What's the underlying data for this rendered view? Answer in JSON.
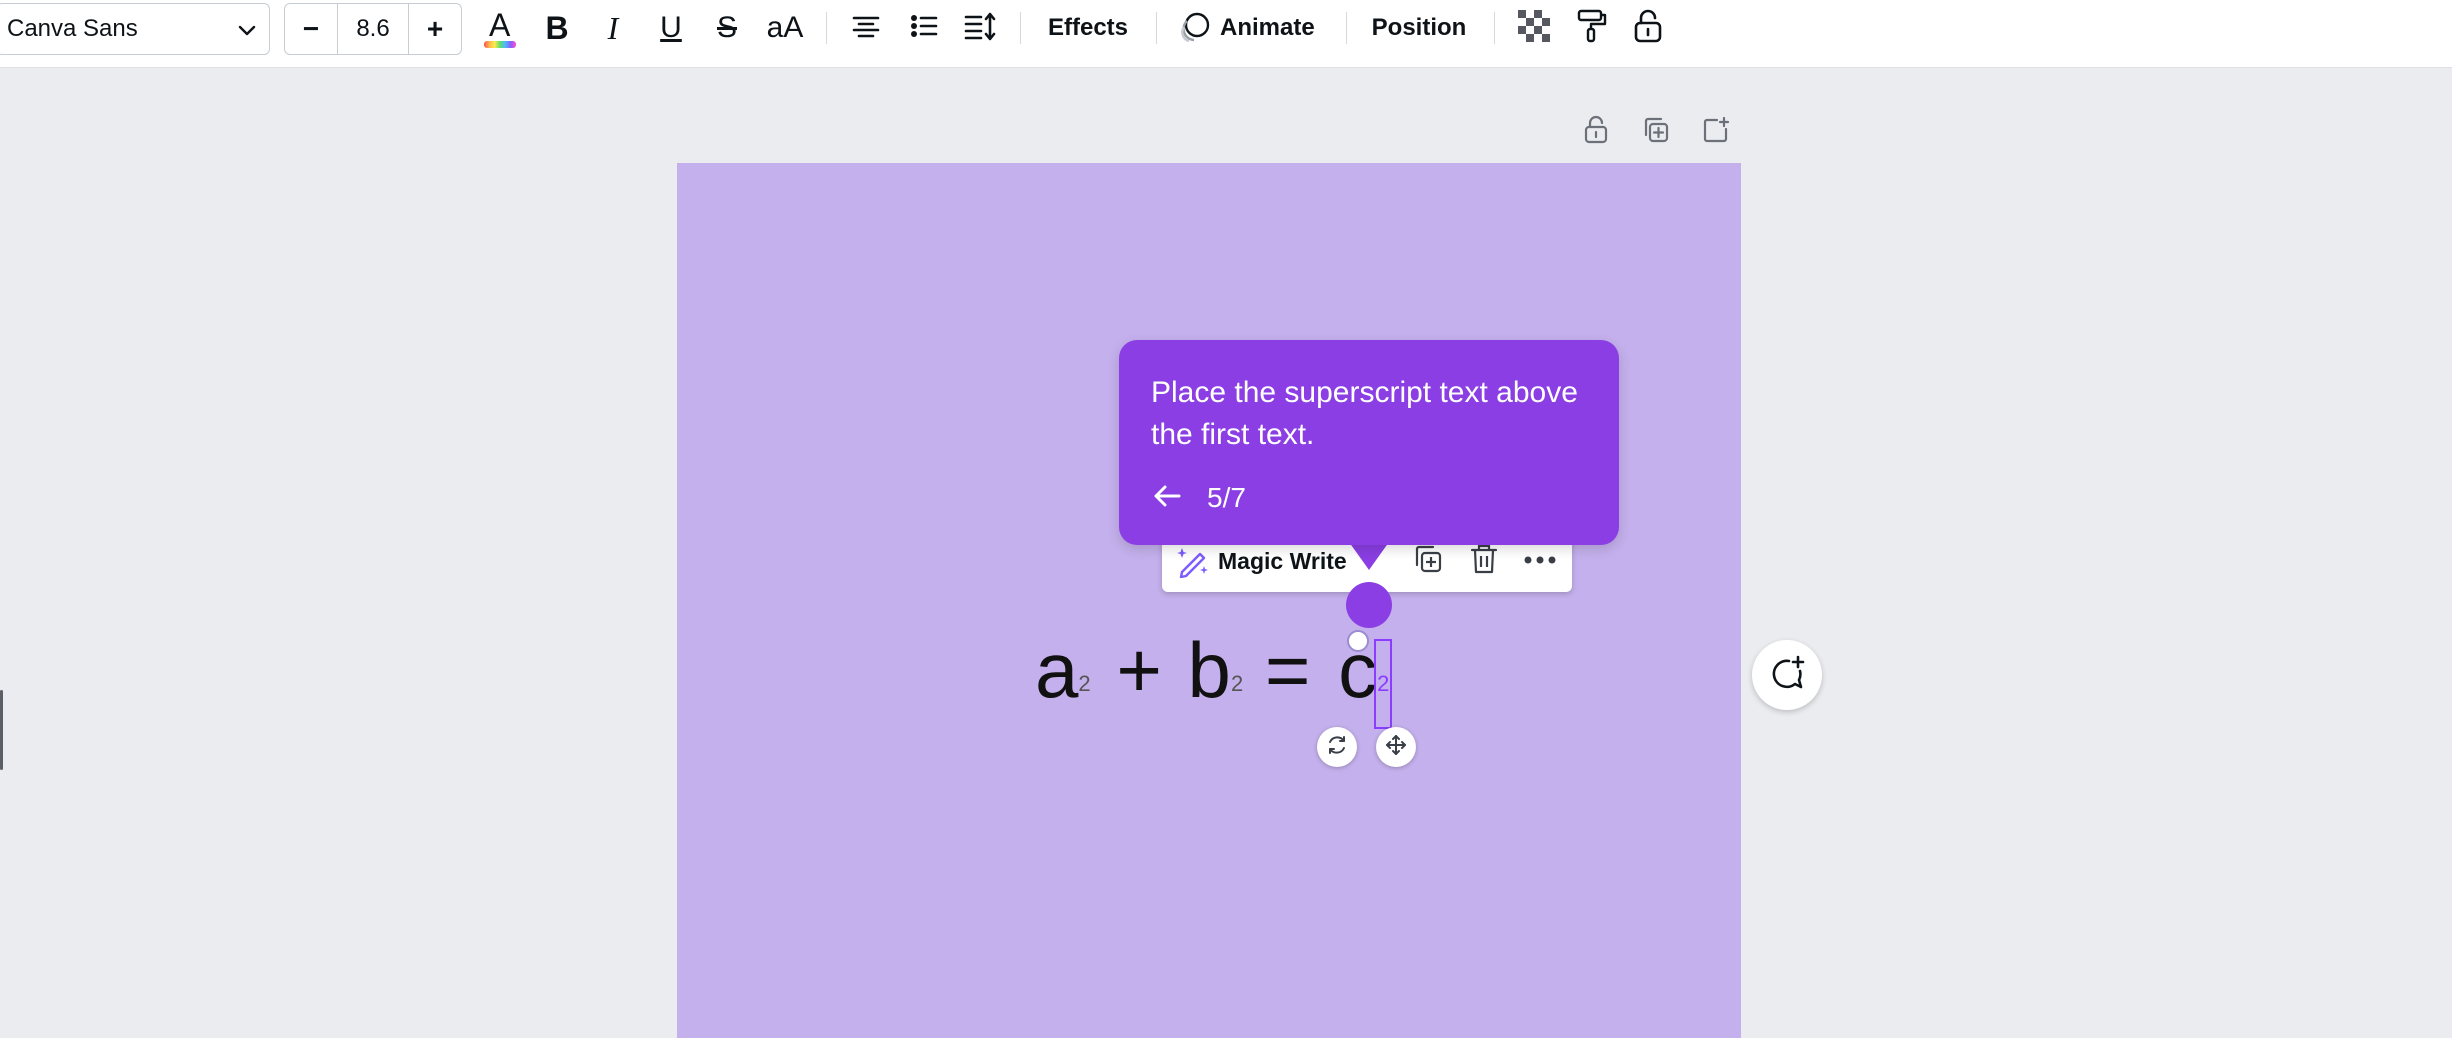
{
  "toolbar": {
    "font_name": "Canva Sans",
    "font_size": "8.6",
    "decrease_label": "−",
    "increase_label": "+",
    "bold_label": "B",
    "italic_label": "I",
    "underline_label": "U",
    "strike_label": "S",
    "case_label": "aA",
    "text_color_label": "A",
    "effects_label": "Effects",
    "animate_label": "Animate",
    "position_label": "Position"
  },
  "canvas": {
    "equation": {
      "a": "a",
      "a_sup": "2",
      "plus": "+",
      "b": "b",
      "b_sup": "2",
      "equals": "=",
      "c": "c",
      "c_sup": "2"
    },
    "background_color": "#c4b0ec"
  },
  "context_toolbar": {
    "magic_write_label": "Magic Write"
  },
  "tooltip": {
    "message": "Place the superscript text above the first text.",
    "step": "5/7",
    "color": "#8b3ee3"
  },
  "icons": [
    "chevron-down-icon",
    "text-color-icon",
    "align-center-icon",
    "bullet-list-icon",
    "line-spacing-icon",
    "animate-icon",
    "transparency-icon",
    "paint-roller-icon",
    "lock-icon",
    "page-lock-icon",
    "duplicate-page-icon",
    "add-page-icon",
    "magic-write-icon",
    "duplicate-icon",
    "trash-icon",
    "more-icon",
    "arrow-left-icon",
    "rotate-icon",
    "move-icon",
    "add-comment-icon"
  ]
}
